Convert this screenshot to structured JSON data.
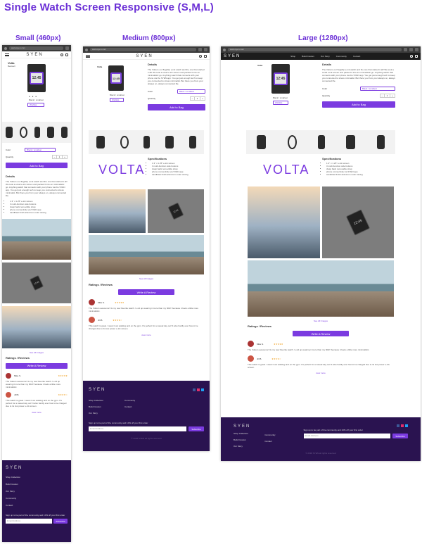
{
  "page_title": "Single Watch Screen Responsive (S,M,L)",
  "columns": [
    {
      "label": "Small (460px)"
    },
    {
      "label": "Medium (800px)"
    },
    {
      "label": "Large (1280px)"
    }
  ],
  "browser": {
    "url": "www.syen.com"
  },
  "brand": "SYEN",
  "nav_links": [
    "Shop",
    "Build Custom",
    "Our Story",
    "Community",
    "Contact"
  ],
  "product": {
    "name": "Volta",
    "sub": "Bestsell",
    "display": "VOLTA",
    "watch_time": "12:45",
    "swatch_label": "Black / smallest",
    "wishlist_label": "Wishlist"
  },
  "details": {
    "heading": "Details",
    "text": "The Volta is our flagship e-ink watch and the one that started it all! We took a small e-ink screen and packed it into an minimalistic go. Anything watch that connects with your phone via the SYEN app. You get just enough tech to keep you connected to stress minimalist. But there you from your always on, always connected life.",
    "color_label": "Color",
    "color_value": "Black / smallest",
    "quantity_label": "Quantity",
    "quantity_value": "1",
    "minus": "−",
    "plus": "+",
    "add_to_bag": "Add to Bag"
  },
  "specs": {
    "heading": "Specifications",
    "items": [
      "1.3\" x 1.25\" e-ink screen",
      "3 multi-function side buttons",
      "clasp back removable strap",
      "phone connectivity via SYEN app",
      "sandblast finish aluminum outer casing"
    ]
  },
  "reviews": {
    "heading": "Ratings / Reviews",
    "write_button": "Write A Review",
    "view_more": "view more",
    "items": [
      {
        "name": "Mike S.",
        "stars": "★★★★★",
        "text": "The Volta is awesome! Its my new favorite watch. I end up wearing it more than my fitbit!! because it feels a little more minimalistic."
      },
      {
        "name": "Jill B.",
        "stars": "★★★★☆",
        "text": "This watch is great. I wear it out walking and on the gym. It's perfect for a casual day out! It also hardly ever has to be charged due to its low power e-ink screen."
      }
    ]
  },
  "see_all": "See All Images",
  "footer": {
    "brand": "SYEN",
    "links_a": [
      "Shop Collection",
      "Build Custom",
      "Our Story"
    ],
    "links_b": [
      "Community",
      "Contact"
    ],
    "links_small": [
      "Shop Collection",
      "Build Custom",
      "Our Story",
      "Community",
      "Contact"
    ],
    "signup_text": "Sign up to be part of the community and 10% off your first order",
    "email_placeholder": "Email Address",
    "subscribe": "Subscribe",
    "copyright": "© 2018 SYEN all rights reserved"
  },
  "colors": {
    "accent": "#7b3be0",
    "footer_bg": "#2a1350",
    "title": "#6b2fd6"
  }
}
